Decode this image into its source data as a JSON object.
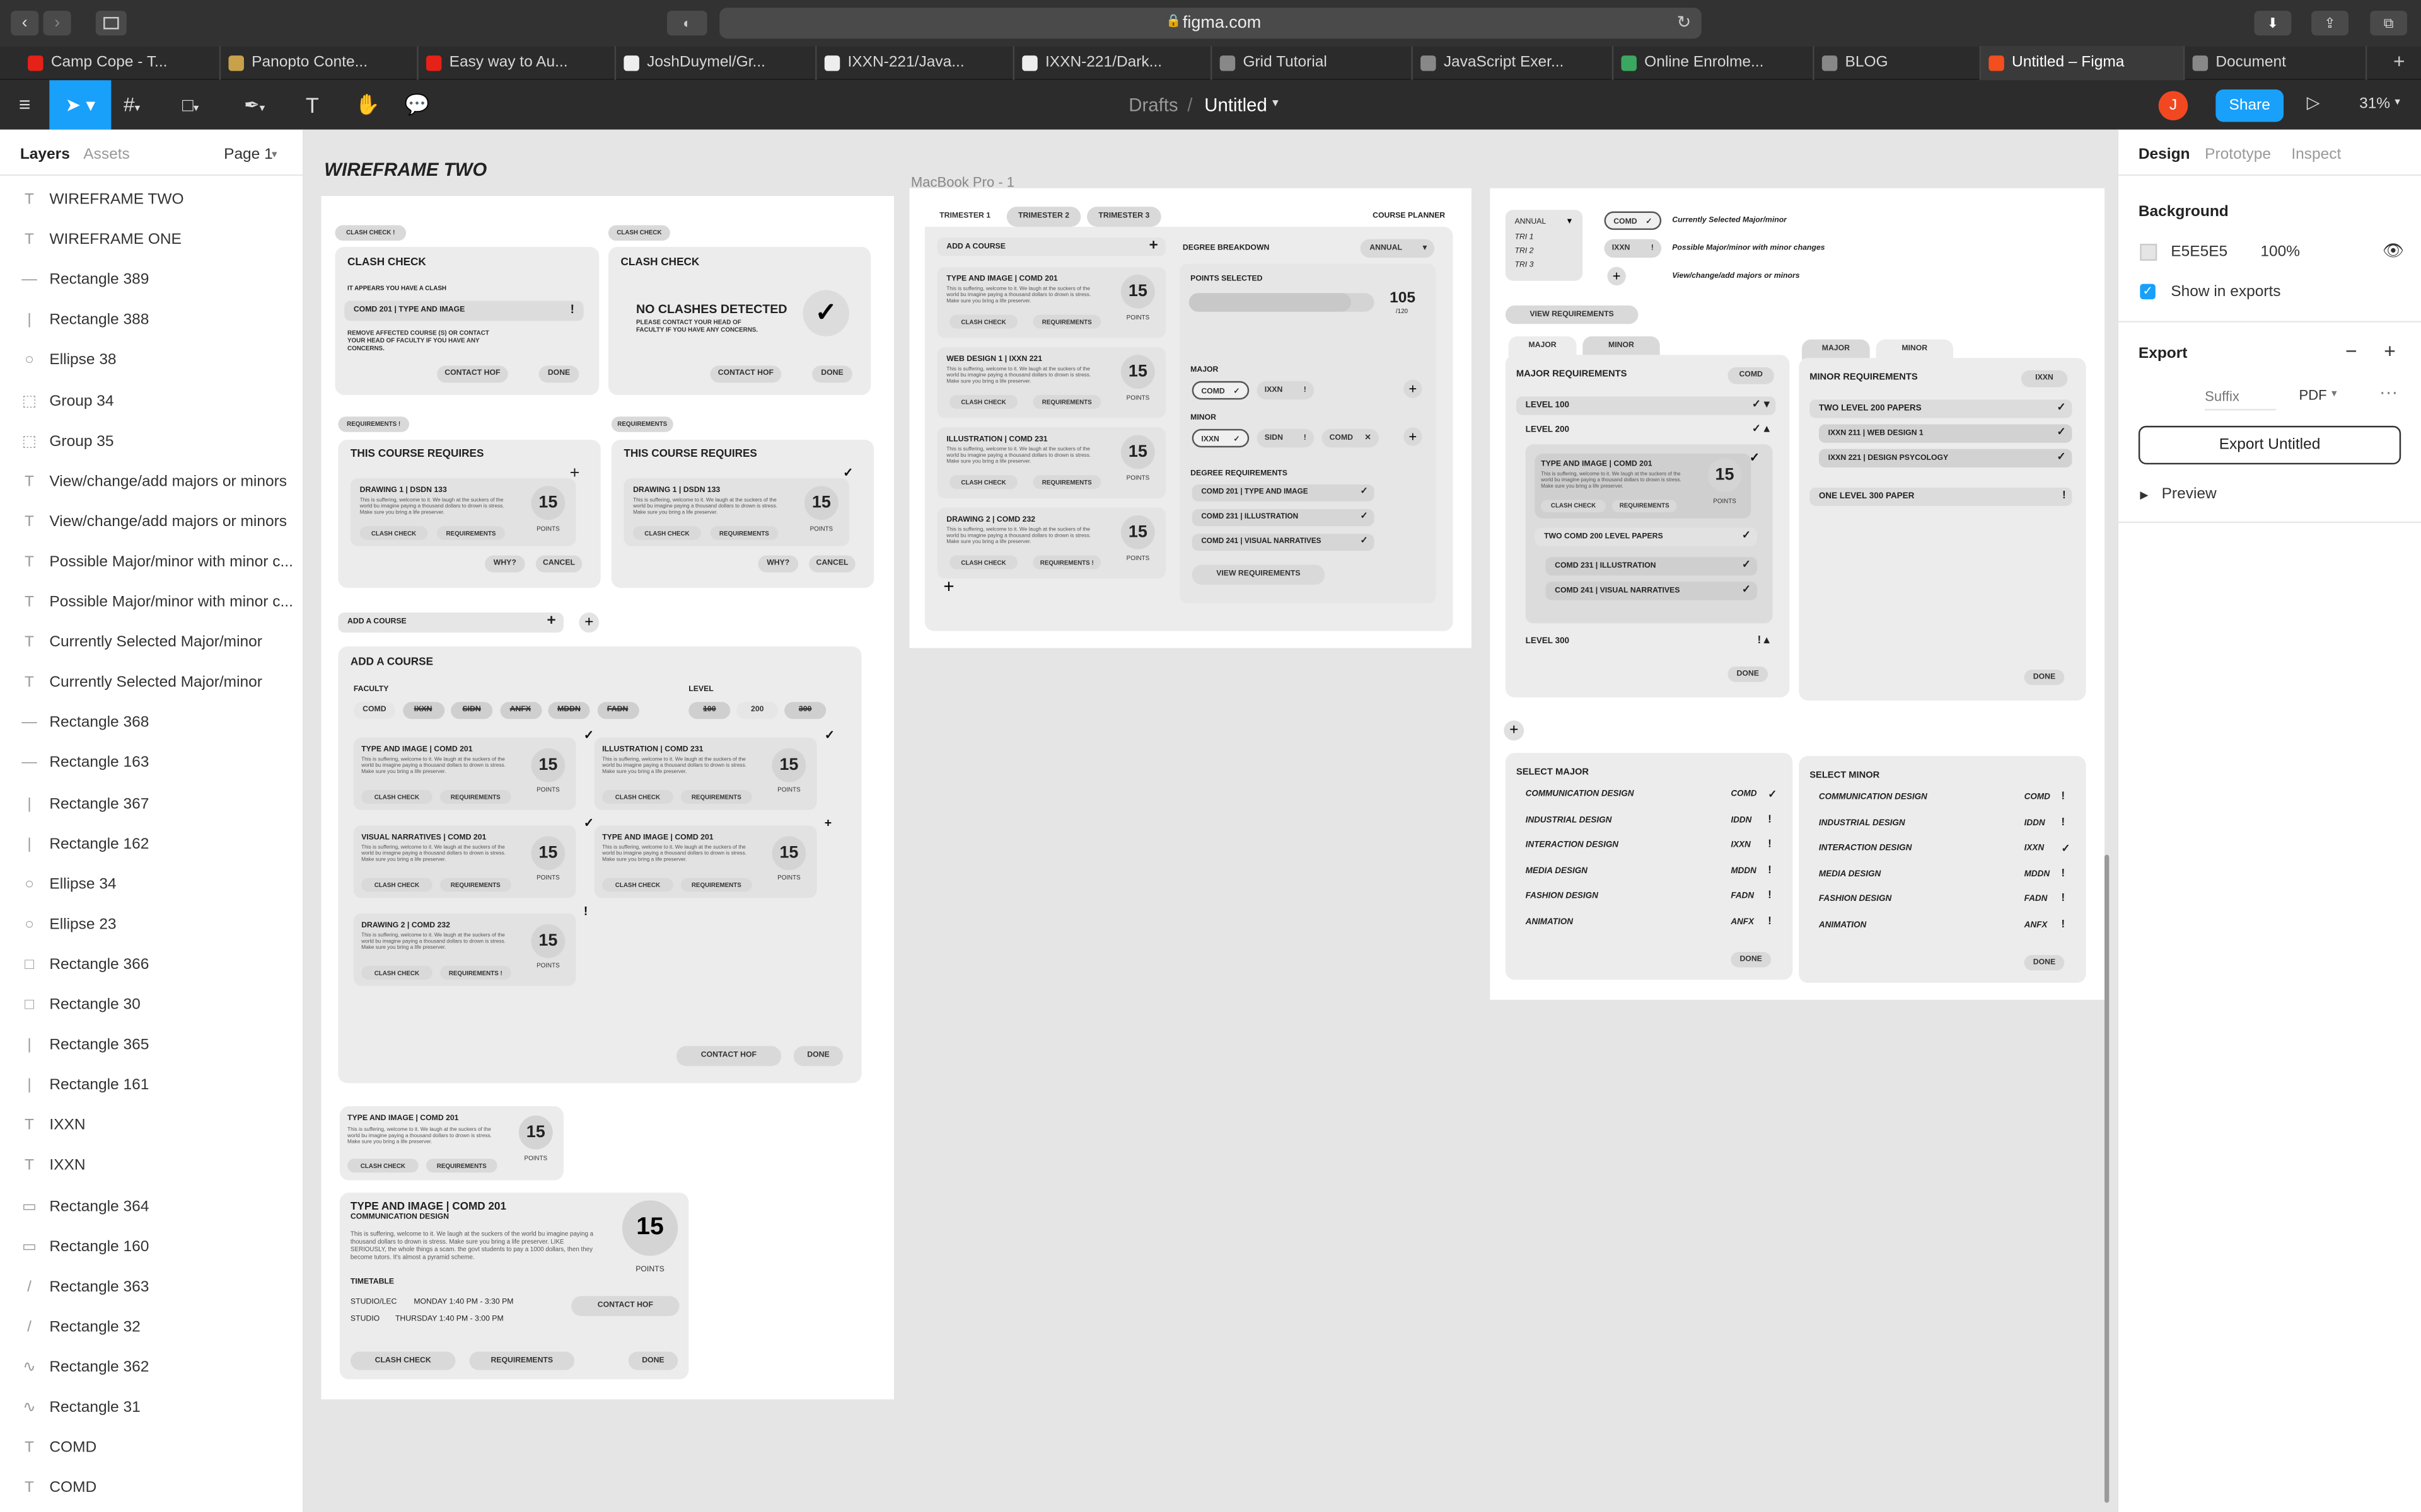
{
  "browser": {
    "url": "figma.com",
    "tabs": [
      "Camp Cope - T...",
      "Panopto Conte...",
      "Easy way to Au...",
      "JoshDuymel/Gr...",
      "IXXN-221/Java...",
      "IXXN-221/Dark...",
      "Grid Tutorial",
      "JavaScript Exer...",
      "Online Enrolme...",
      "BLOG",
      "Untitled – Figma",
      "Document"
    ],
    "tab_colors": [
      "#e62117",
      "#c7a24a",
      "#e62117",
      "#eeeeee",
      "#eeeeee",
      "#eeeeee",
      "#888888",
      "#888888",
      "#3aa860",
      "#888888",
      "#f24e1e",
      "#888888"
    ]
  },
  "figma": {
    "breadcrumb_drafts": "Drafts",
    "breadcrumb_sep": "/",
    "file_name": "Untitled",
    "avatar": "J",
    "share": "Share",
    "zoom": "31%"
  },
  "layers_panel": {
    "tab_layers": "Layers",
    "tab_assets": "Assets",
    "page": "Page 1",
    "items": [
      {
        "icon": "T",
        "label": "WIREFRAME TWO"
      },
      {
        "icon": "T",
        "label": "WIREFRAME ONE"
      },
      {
        "icon": "—",
        "label": "Rectangle 389"
      },
      {
        "icon": "|",
        "label": "Rectangle 388"
      },
      {
        "icon": "○",
        "label": "Ellipse 38"
      },
      {
        "icon": "⬚",
        "label": "Group 34"
      },
      {
        "icon": "⬚",
        "label": "Group 35"
      },
      {
        "icon": "T",
        "label": "View/change/add majors or minors"
      },
      {
        "icon": "T",
        "label": "View/change/add majors or minors"
      },
      {
        "icon": "T",
        "label": "Possible Major/minor with minor c..."
      },
      {
        "icon": "T",
        "label": "Possible Major/minor with minor c..."
      },
      {
        "icon": "T",
        "label": "Currently Selected Major/minor"
      },
      {
        "icon": "T",
        "label": "Currently Selected Major/minor"
      },
      {
        "icon": "—",
        "label": "Rectangle 368"
      },
      {
        "icon": "—",
        "label": "Rectangle 163"
      },
      {
        "icon": "|",
        "label": "Rectangle 367"
      },
      {
        "icon": "|",
        "label": "Rectangle 162"
      },
      {
        "icon": "○",
        "label": "Ellipse 34"
      },
      {
        "icon": "○",
        "label": "Ellipse 23"
      },
      {
        "icon": "□",
        "label": "Rectangle 366"
      },
      {
        "icon": "□",
        "label": "Rectangle 30"
      },
      {
        "icon": "|",
        "label": "Rectangle 365"
      },
      {
        "icon": "|",
        "label": "Rectangle 161"
      },
      {
        "icon": "T",
        "label": "IXXN"
      },
      {
        "icon": "T",
        "label": "IXXN"
      },
      {
        "icon": "▭",
        "label": "Rectangle 364"
      },
      {
        "icon": "▭",
        "label": "Rectangle 160"
      },
      {
        "icon": "/",
        "label": "Rectangle 363"
      },
      {
        "icon": "/",
        "label": "Rectangle 32"
      },
      {
        "icon": "∿",
        "label": "Rectangle 362"
      },
      {
        "icon": "∿",
        "label": "Rectangle 31"
      },
      {
        "icon": "T",
        "label": "COMD"
      },
      {
        "icon": "T",
        "label": "COMD"
      }
    ]
  },
  "design_panel": {
    "tab_design": "Design",
    "tab_prototype": "Prototype",
    "tab_inspect": "Inspect",
    "background_label": "Background",
    "bg_hex": "E5E5E5",
    "bg_opacity": "100%",
    "show_in_exports": "Show in exports",
    "export_label": "Export",
    "suffix_placeholder": "Suffix",
    "format": "PDF",
    "export_button": "Export Untitled",
    "preview": "Preview",
    "swatch_color": "#e5e5e5"
  },
  "canvas": {
    "wireframe_title": "WIREFRAME TWO",
    "frame_label": "MacBook Pro - 1"
  },
  "w2": {
    "clash_tag": "CLASH CHECK",
    "clash_title": "CLASH CHECK",
    "clash_msg": "IT APPEARS YOU HAVE A CLASH",
    "clash_course": "COMD 201 | TYPE AND IMAGE",
    "clash_remove": "REMOVE AFFECTED COURSE (S) OR CONTACT YOUR HEAD OF FACULTY IF YOU HAVE ANY CONCERNS.",
    "contact_hof": "CONTACT HOF",
    "done": "DONE",
    "noclash_title": "NO CLASHES DETECTED",
    "noclash_sub": "PLEASE CONTACT YOUR HEAD OF FACULTY IF YOU HAVE ANY CONCERNS.",
    "req_tag": "REQUIREMENTS",
    "req_title": "THIS COURSE REQUIRES",
    "drawing1": "DRAWING 1 | DSDN 133",
    "why": "WHY?",
    "cancel": "CANCEL",
    "lorem": "This is suffering, welcome to it. We laugh at the suckers of the world bu imagine paying a thousand dollars to drown is stress. Make sure you bring a life preserver.",
    "clash_check": "CLASH CHECK",
    "requirements": "REQUIREMENTS",
    "points": "POINTS",
    "pts15": "15",
    "add_course_bar": "ADD A COURSE",
    "add_course_title": "ADD A COURSE",
    "faculty": "FACULTY",
    "level": "LEVEL",
    "faculties": [
      "COMD",
      "IXXN",
      "SIDN",
      "ANFX",
      "MDDN",
      "FADN"
    ],
    "levels": [
      "100",
      "200",
      "300"
    ],
    "courses": [
      "TYPE AND IMAGE | COMD 201",
      "ILLUSTRATION | COMD 231",
      "VISUAL NARRATIVES | COMD 201",
      "TYPE AND IMAGE | COMD 201",
      "DRAWING 2 | COMD 232"
    ],
    "small_card_title": "TYPE AND IMAGE | COMD 201",
    "big_title": "TYPE AND IMAGE | COMD 201",
    "big_sub": "COMMUNICATION DESIGN",
    "big_desc": "This is suffering, welcome to it. We laugh at the suckers of the world bu imagine paying a thousand dollars to drown is stress. Make sure you bring a life preserver. LIKE SERIOUSLY, the whole things a scam. the govt students to pay a 1000 dollars, then they become tutors. It's almost a pyramid scheme.",
    "timetable": "TIMETABLE",
    "tt1a": "STUDIO/LEC",
    "tt1b": "MONDAY 1:40 PM - 3:30 PM",
    "tt2a": "STUDIO",
    "tt2b": "THURSDAY 1:40 PM - 3:00 PM"
  },
  "mb": {
    "tri1": "TRIMESTER 1",
    "tri2": "TRIMESTER 2",
    "tri3": "TRIMESTER 3",
    "planner": "COURSE PLANNER",
    "add_course": "ADD A COURSE",
    "courses": [
      "TYPE AND IMAGE | COMD 201",
      "WEB DESIGN 1 | IXXN 221",
      "ILLUSTRATION | COMD 231",
      "DRAWING 2 | COMD 232"
    ],
    "degree_breakdown": "DEGREE BREAKDOWN",
    "annual": "ANNUAL",
    "points_selected": "POINTS SELECTED",
    "points_value": "105",
    "points_total": "/120",
    "major": "MAJOR",
    "minor": "MINOR",
    "major_tags": [
      "COMD",
      "IXXN"
    ],
    "minor_tags": [
      "IXXN",
      "SIDN",
      "COMD"
    ],
    "degree_req": "DEGREE REQUIREMENTS",
    "degree_items": [
      "COMD 201 | TYPE AND IMAGE",
      "COMD 231 | ILLUSTRATION",
      "COMD 241 | VISUAL NARRATIVES"
    ],
    "view_req": "VIEW REQUIREMENTS"
  },
  "rf": {
    "annual": "ANNUAL",
    "tris": [
      "TRI 1",
      "TRI 2",
      "TRI 3"
    ],
    "legend": [
      {
        "tag": "COMD",
        "text": "Currently Selected Major/minor"
      },
      {
        "tag": "IXXN",
        "text": "Possible Major/minor with minor changes"
      },
      {
        "tag": "+",
        "text": "View/change/add majors or minors"
      }
    ],
    "view_req": "VIEW REQUIREMENTS",
    "major_tab": "MAJOR",
    "minor_tab": "MINOR",
    "major_req_title": "MAJOR REQUIREMENTS",
    "major_code": "COMD",
    "levels": [
      "LEVEL 100",
      "LEVEL 200",
      "LEVEL 300"
    ],
    "l200_card": "TYPE AND IMAGE | COMD 201",
    "two_comd": "TWO COMD 200 LEVEL PAPERS",
    "comd231": "COMD 231 | ILLUSTRATION",
    "comd241": "COMD 241 | VISUAL NARRATIVES",
    "minor_req_title": "MINOR REQUIREMENTS",
    "minor_code": "IXXN",
    "two_level": "TWO LEVEL 200 PAPERS",
    "ixxn211": "IXXN 211 | WEB DESIGN 1",
    "ixxn221": "IXXN 221 | DESIGN PSYCOLOGY",
    "one_level": "ONE LEVEL 300 PAPER",
    "done": "DONE",
    "select_major": "SELECT MAJOR",
    "select_minor": "SELECT MINOR",
    "programs": [
      {
        "name": "COMMUNICATION DESIGN",
        "code": "COMD"
      },
      {
        "name": "INDUSTRIAL DESIGN",
        "code": "IDDN"
      },
      {
        "name": "INTERACTION DESIGN",
        "code": "IXXN"
      },
      {
        "name": "MEDIA DESIGN",
        "code": "MDDN"
      },
      {
        "name": "FASHION DESIGN",
        "code": "FADN"
      },
      {
        "name": "ANIMATION",
        "code": "ANFX"
      }
    ],
    "major_marks": [
      "✓",
      "!",
      "!",
      "!",
      "!",
      "!"
    ],
    "minor_marks": [
      "!",
      "!",
      "✓",
      "!",
      "!",
      "!"
    ]
  }
}
